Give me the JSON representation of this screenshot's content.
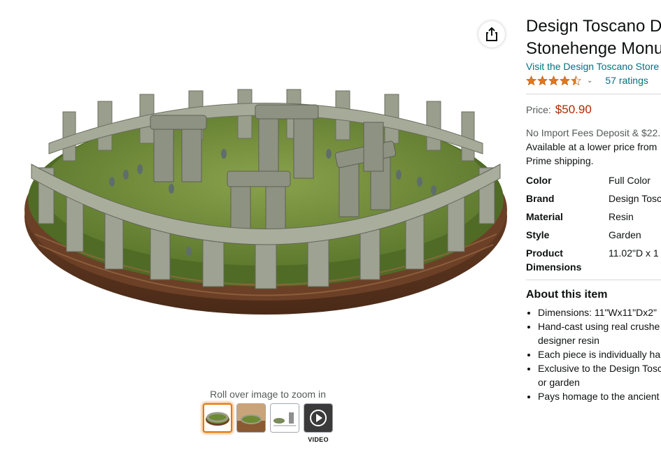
{
  "product": {
    "title_line1": "Design Toscano Di",
    "title_line2": "Stonehenge Monu",
    "store_link": "Visit the Design Toscano Store",
    "rating_value": 4.5,
    "ratings_count": "57 ratings"
  },
  "price": {
    "label": "Price:",
    "value": "$50.90"
  },
  "shipping": {
    "import_fees": "No Import Fees Deposit & $22.",
    "lower_price_line1": "Available at a lower price from",
    "lower_price_line2": "Prime shipping."
  },
  "specs": [
    {
      "key": "Color",
      "value": "Full Color"
    },
    {
      "key": "Brand",
      "value": "Design Tosc"
    },
    {
      "key": "Material",
      "value": "Resin"
    },
    {
      "key": "Style",
      "value": "Garden"
    },
    {
      "key": "Product",
      "key2": "Dimensions",
      "value": "11.02\"D x 1"
    }
  ],
  "about": {
    "heading": "About this item",
    "bullets": [
      {
        "line1": "Dimensions: 11\"Wx11\"Dx2\"",
        "line2": ""
      },
      {
        "line1": "Hand-cast using real crushe",
        "line2": "designer resin"
      },
      {
        "line1": "Each piece is individually ha",
        "line2": ""
      },
      {
        "line1": "Exclusive to the Design Tosc",
        "line2": "or garden"
      },
      {
        "line1": "Pays homage to the ancient",
        "line2": ""
      }
    ]
  },
  "gallery": {
    "zoom_hint": "Roll over image to zoom in",
    "video_label": "VIDEO",
    "thumbnails": [
      "stonehenge-top",
      "stonehenge-scene",
      "stonehenge-dimensions",
      "stonehenge-video"
    ]
  },
  "colors": {
    "link": "#007185",
    "price": "#b12704",
    "star": "#de7921",
    "thumb_selected": "#e77600"
  }
}
